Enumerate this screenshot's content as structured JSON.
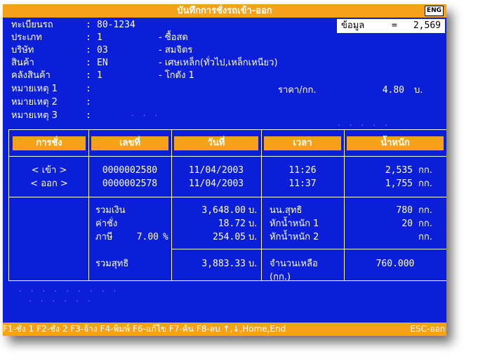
{
  "window": {
    "title": "บันทึกการชั่งรถเข้า-ออก",
    "lang_badge": "ENG"
  },
  "header": {
    "data_count": {
      "label": "ข้อมูล",
      "equals": "=",
      "value": "2,569"
    },
    "fields": [
      {
        "label": "ทะเบียนรถ",
        "value": "80-1234",
        "desc": ""
      },
      {
        "label": "ประเภท",
        "value": "1",
        "desc": "- ซื้อสด"
      },
      {
        "label": "บริษัท",
        "value": "03",
        "desc": "- สมจิตร"
      },
      {
        "label": "สินค้า",
        "value": "EN",
        "desc": "- เศษเหล็ก(ทั่วไป,เหล็กเหนียว)"
      },
      {
        "label": "คลังสินค้า",
        "value": "1",
        "desc": "- โกดัง 1"
      },
      {
        "label": "หมายเหตุ 1",
        "value": "",
        "desc": ""
      },
      {
        "label": "หมายเหตุ 2",
        "value": "",
        "desc": ""
      },
      {
        "label": "หมายเหตุ 3",
        "value": "",
        "desc": ""
      }
    ],
    "price": {
      "label": "ราคา/กก.",
      "value": "4.80",
      "unit": "บ."
    }
  },
  "table": {
    "headers": [
      "การชั่ง",
      "เลขที่",
      "วันที่",
      "เวลา",
      "น้ำหนัก"
    ],
    "rows": [
      {
        "direction": "< เข้า >",
        "doc_no": "0000002580",
        "date": "11/04/2003",
        "time": "11:26",
        "weight": "2,535",
        "unit": "กก."
      },
      {
        "direction": "< ออก >",
        "doc_no": "0000002578",
        "date": "11/04/2003",
        "time": "11:37",
        "weight": "1,755",
        "unit": "กก."
      }
    ]
  },
  "summary": {
    "total": {
      "label": "รวมเงิน",
      "value": "3,648.00",
      "unit": "บ."
    },
    "fee": {
      "label": "ค่าชั่ง",
      "value": "18.72",
      "unit": "บ."
    },
    "tax": {
      "label": "ภาษี",
      "rate": "7.00",
      "pct": "%",
      "value": "254.05",
      "unit": "บ."
    },
    "net_total": {
      "label": "รวมสุทธิ",
      "value": "3,883.33",
      "unit": "บ."
    },
    "net_weight": {
      "label": "นน.สุทธิ",
      "value": "780",
      "unit": "กก."
    },
    "deduct1": {
      "label": "หักน้ำหนัก 1",
      "value": "20",
      "unit": "กก."
    },
    "deduct2": {
      "label": "หักน้ำหนัก 2",
      "value": "",
      "unit": "กก."
    },
    "remaining": {
      "label": "จำนวนเหลือ",
      "unit_label": "(กก.)",
      "value": "760.000"
    }
  },
  "statusbar": {
    "keys": "F1-ชั่ง 1 F2-ชั่ง 2 F3-จ้าง F4-พิมพ์ F6-แก้ไข F7-ค้น F8-ลบ ↑,↓,Home,End",
    "esc": "ESC-ออก"
  },
  "colors": {
    "background": "#0b1fd8",
    "accent": "#f5a21a",
    "text": "#ffffff"
  }
}
